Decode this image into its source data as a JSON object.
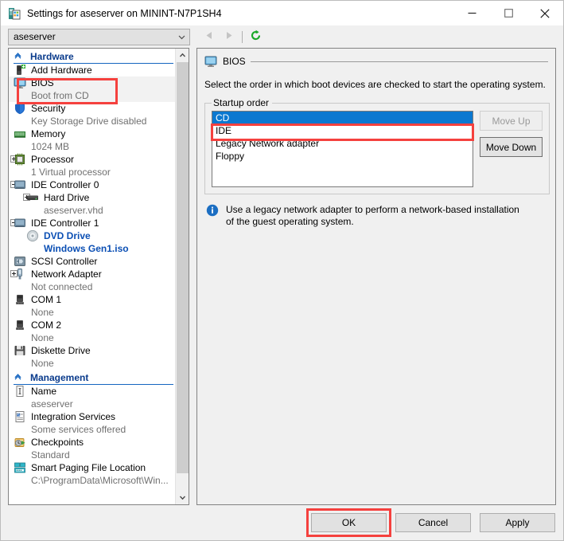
{
  "window": {
    "title": "Settings for aseserver on MININT-N7P1SH4",
    "icon": "vm-settings-icon",
    "caption_buttons": [
      {
        "name": "minimize-button",
        "glyph": "minimize-icon"
      },
      {
        "name": "maximize-button",
        "glyph": "maximize-icon"
      },
      {
        "name": "close-button",
        "glyph": "close-icon"
      }
    ]
  },
  "toolbar": {
    "vm_select_value": "aseserver",
    "vm_select_icon": "chevron-down-icon",
    "back_icon": "back-arrow-icon",
    "forward_icon": "forward-arrow-icon",
    "refresh_icon": "refresh-icon",
    "refresh_color": "#1aa828"
  },
  "tree": {
    "sections": [
      {
        "label": "Hardware",
        "collapse_icon": "chevron-up-icon",
        "items": [
          {
            "label": "Add Hardware",
            "sub": "",
            "icon": "add-hardware-icon",
            "expander": "none",
            "indent": 0,
            "selected": false,
            "link": false
          },
          {
            "label": "BIOS",
            "sub": "Boot from CD",
            "icon": "bios-monitor-icon",
            "expander": "none",
            "indent": 0,
            "selected": true,
            "link": false
          },
          {
            "label": "Security",
            "sub": "Key Storage Drive disabled",
            "icon": "shield-icon",
            "expander": "none",
            "indent": 0,
            "selected": false,
            "link": false
          },
          {
            "label": "Memory",
            "sub": "1024 MB",
            "icon": "memory-icon",
            "expander": "none",
            "indent": 0,
            "selected": false,
            "link": false
          },
          {
            "label": "Processor",
            "sub": "1 Virtual processor",
            "icon": "processor-icon",
            "expander": "plus",
            "indent": 0,
            "selected": false,
            "link": false
          },
          {
            "label": "IDE Controller 0",
            "sub": "",
            "icon": "ide-controller-icon",
            "expander": "minus",
            "indent": 0,
            "selected": false,
            "link": false
          },
          {
            "label": "Hard Drive",
            "sub": "aseserver.vhd",
            "icon": "hard-drive-icon",
            "expander": "plus",
            "indent": 1,
            "selected": false,
            "link": false
          },
          {
            "label": "IDE Controller 1",
            "sub": "",
            "icon": "ide-controller-icon",
            "expander": "minus",
            "indent": 0,
            "selected": false,
            "link": false
          },
          {
            "label": "DVD Drive",
            "sub": "Windows Gen1.iso",
            "icon": "dvd-drive-icon",
            "expander": "none",
            "indent": 1,
            "selected": false,
            "link": true
          },
          {
            "label": "SCSI Controller",
            "sub": "",
            "icon": "scsi-controller-icon",
            "expander": "none",
            "indent": 0,
            "selected": false,
            "link": false
          },
          {
            "label": "Network Adapter",
            "sub": "Not connected",
            "icon": "network-adapter-icon",
            "expander": "plus",
            "indent": 0,
            "selected": false,
            "link": false
          },
          {
            "label": "COM 1",
            "sub": "None",
            "icon": "com-port-icon",
            "expander": "none",
            "indent": 0,
            "selected": false,
            "link": false
          },
          {
            "label": "COM 2",
            "sub": "None",
            "icon": "com-port-icon",
            "expander": "none",
            "indent": 0,
            "selected": false,
            "link": false
          },
          {
            "label": "Diskette Drive",
            "sub": "None",
            "icon": "floppy-icon",
            "expander": "none",
            "indent": 0,
            "selected": false,
            "link": false
          }
        ]
      },
      {
        "label": "Management",
        "collapse_icon": "chevron-up-icon",
        "items": [
          {
            "label": "Name",
            "sub": "aseserver",
            "icon": "name-icon",
            "expander": "none",
            "indent": 0,
            "selected": false,
            "link": false
          },
          {
            "label": "Integration Services",
            "sub": "Some services offered",
            "icon": "integration-services-icon",
            "expander": "none",
            "indent": 0,
            "selected": false,
            "link": false
          },
          {
            "label": "Checkpoints",
            "sub": "Standard",
            "icon": "checkpoints-icon",
            "expander": "none",
            "indent": 0,
            "selected": false,
            "link": false
          },
          {
            "label": "Smart Paging File Location",
            "sub": "C:\\ProgramData\\Microsoft\\Win...",
            "icon": "smart-paging-icon",
            "expander": "none",
            "indent": 0,
            "selected": false,
            "link": false
          }
        ]
      }
    ],
    "scroll_up_icon": "chevron-up-icon",
    "scroll_down_icon": "chevron-down-icon"
  },
  "detail": {
    "header_title": "BIOS",
    "header_icon": "bios-monitor-icon",
    "intro": "Select the order in which boot devices are checked to start the operating system.",
    "group_label": "Startup order",
    "boot_items": [
      {
        "label": "CD",
        "selected": true
      },
      {
        "label": "IDE",
        "selected": false
      },
      {
        "label": "Legacy Network adapter",
        "selected": false
      },
      {
        "label": "Floppy",
        "selected": false
      }
    ],
    "move_up_label": "Move Up",
    "move_up_enabled": false,
    "move_down_label": "Move Down",
    "move_down_enabled": true,
    "note_icon": "info-icon",
    "note_text": "Use a legacy network adapter to perform a network-based installation of the guest operating system."
  },
  "footer": {
    "ok_label": "OK",
    "cancel_label": "Cancel",
    "apply_label": "Apply"
  },
  "annotations": {
    "highlight_color": "#f5413e",
    "boxes": [
      "bios-tree-item",
      "cd-boot-item",
      "ok-button"
    ]
  }
}
